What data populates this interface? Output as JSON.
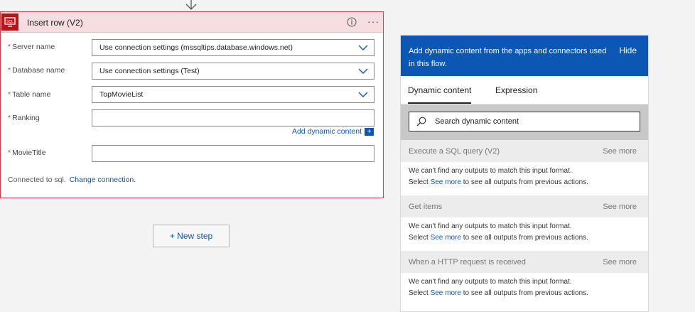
{
  "card": {
    "title": "Insert row (V2)",
    "info_icon": "info-icon",
    "more_icon": "more-options-icon",
    "more_label": "···",
    "fields": [
      {
        "label": "Server name",
        "value": "Use connection settings (mssqltips.database.windows.net)",
        "dropdown": true
      },
      {
        "label": "Database name",
        "value": "Use connection settings (Test)",
        "dropdown": true
      },
      {
        "label": "Table name",
        "value": "TopMovieList",
        "dropdown": true
      },
      {
        "label": "Ranking",
        "value": "",
        "dropdown": false
      },
      {
        "label": "MovieTitle",
        "value": "",
        "dropdown": false
      }
    ],
    "required_mark": "*",
    "add_dynamic_label": "Add dynamic content",
    "connected_text": "Connected to sql.",
    "change_connection": "Change connection."
  },
  "new_step": "+ New step",
  "panel": {
    "header_text": "Add dynamic content from the apps and connectors used in this flow.",
    "hide": "Hide",
    "tabs": [
      "Dynamic content",
      "Expression"
    ],
    "search_placeholder": "Search dynamic content",
    "see_more": "See more",
    "sections": [
      {
        "name": "Execute a SQL query (V2)"
      },
      {
        "name": "Get items"
      },
      {
        "name": "When a HTTP request is received"
      }
    ],
    "empty_line1": "We can't find any outputs to match this input format.",
    "empty_line2_pre": "Select ",
    "empty_line2_link": "See more",
    "empty_line2_post": " to see all outputs from previous actions."
  },
  "colors": {
    "accent": "#0b57b3",
    "error_border": "#c4414e",
    "header_bg": "#f6dde0",
    "sql_icon": "#ba141a"
  }
}
